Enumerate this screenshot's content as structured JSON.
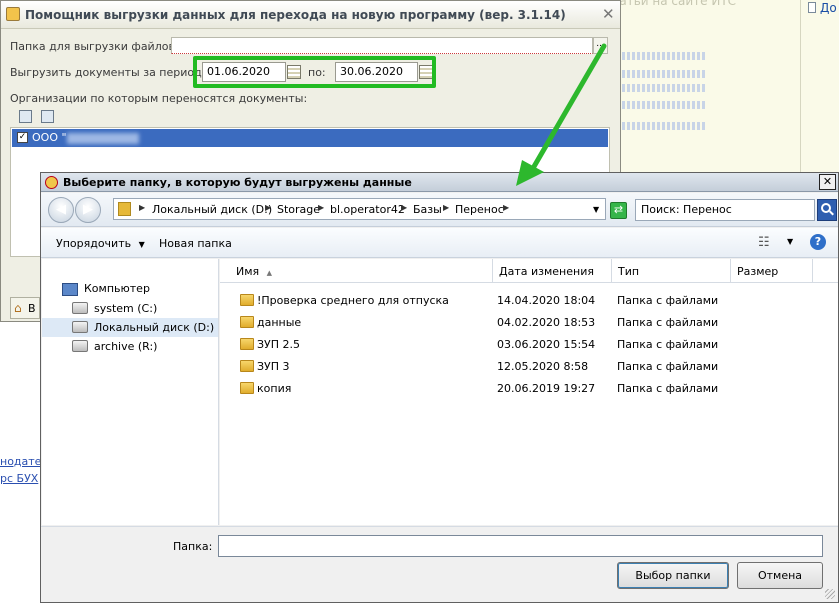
{
  "background": {
    "top_text": "Статьи на сайте ИТС",
    "doc_link": "До",
    "left_links": [
      "нодател",
      "рс БУХ"
    ]
  },
  "assistant": {
    "title": "Помощник выгрузки данных для перехода на новую программу (вер. 3.1.14)",
    "folder_label": "Папка для выгрузки файлов:",
    "period_label": "Выгрузить документы за период с:",
    "date_from": "01.06.2020",
    "to_label": "по:",
    "date_to": "30.06.2020",
    "orgs_label": "Организации по которым переносятся документы:",
    "org_name": "ООО \"",
    "bottom_btn": "В"
  },
  "dialog": {
    "title": "Выберите папку, в которую будут выгружены данные",
    "breadcrumbs": [
      "Локальный диск (D:)",
      "Storage",
      "bl.operator42",
      "Базы",
      "Перенос"
    ],
    "search_placeholder": "Поиск: Перенос",
    "toolbar": {
      "organize": "Упорядочить",
      "new_folder": "Новая папка"
    },
    "tree": [
      {
        "label": "Компьютер"
      },
      {
        "label": "system (C:)"
      },
      {
        "label": "Локальный диск (D:)"
      },
      {
        "label": "archive (R:)"
      }
    ],
    "columns": [
      "Имя",
      "Дата изменения",
      "Тип",
      "Размер"
    ],
    "files": [
      {
        "name": "!Проверка среднего для отпуска",
        "date": "14.04.2020 18:04",
        "type": "Папка с файлами"
      },
      {
        "name": "данные",
        "date": "04.02.2020 18:53",
        "type": "Папка с файлами"
      },
      {
        "name": "ЗУП 2.5",
        "date": "03.06.2020 15:54",
        "type": "Папка с файлами"
      },
      {
        "name": "ЗУП 3",
        "date": "12.05.2020 8:58",
        "type": "Папка с файлами"
      },
      {
        "name": "копия",
        "date": "20.06.2019 19:27",
        "type": "Папка с файлами"
      }
    ],
    "folder_field_label": "Папка:",
    "folder_field_value": "",
    "ok_label": "Выбор папки",
    "cancel_label": "Отмена"
  },
  "colors": {
    "highlight": "#22bb22",
    "arrow": "#2db82d",
    "selection": "#3b6bbf"
  }
}
